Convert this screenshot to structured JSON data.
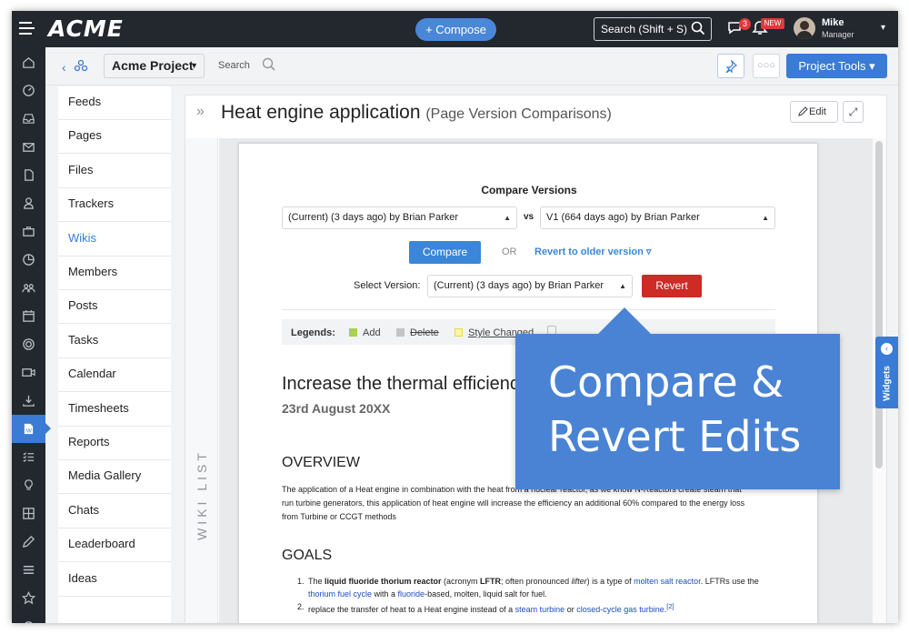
{
  "topbar": {
    "logo": "ACME",
    "compose_label": "+ Compose",
    "search_label": "Search (Shift + S)",
    "chat_badge": "3",
    "bell_badge": "NEW",
    "user_name": "Mike",
    "user_role": "Manager"
  },
  "rail": {
    "icons": [
      "home-icon",
      "dashboard-icon",
      "inbox-icon",
      "mail-icon",
      "file-icon",
      "user-icon",
      "briefcase-icon",
      "pie-chart-icon",
      "group-icon",
      "calendar-icon",
      "target-icon",
      "video-icon",
      "download-icon",
      "wiki-icon",
      "checklist-icon",
      "bulb-icon",
      "grid-icon",
      "pencil-icon",
      "list-icon",
      "star-icon",
      "settings-icon"
    ],
    "active_index": 13
  },
  "subheader": {
    "project": "Acme Project",
    "search_label": "Search",
    "tools_label": "Project Tools",
    "more_label": "○○○"
  },
  "leftnav": {
    "items": [
      "Feeds",
      "Pages",
      "Files",
      "Trackers",
      "Wikis",
      "Members",
      "Posts",
      "Tasks",
      "Calendar",
      "Timesheets",
      "Reports",
      "Media Gallery",
      "Chats",
      "Leaderboard",
      "Ideas"
    ],
    "active": "Wikis"
  },
  "panel": {
    "title": "Heat engine application",
    "subtitle": "(Page Version Comparisons)",
    "edit_label": "Edit",
    "wiki_list_label": "WIKI LIST"
  },
  "compare": {
    "title": "Compare Versions",
    "version_a": "(Current) (3 days ago) by Brian Parker",
    "vs": "vs",
    "version_b": "V1 (664 days ago) by Brian Parker",
    "compare_label": "Compare",
    "or": "OR",
    "revert_older_label": "Revert to older version",
    "select_label": "Select Version:",
    "select_value": "(Current) (3 days ago) by Brian Parker",
    "revert_label": "Revert"
  },
  "legends": {
    "label": "Legends:",
    "add": "Add",
    "delete": "Delete",
    "style": "Style Changed",
    "colors": {
      "add": "#a9cf54",
      "delete": "#c4c4c4",
      "style": "#fff59d"
    }
  },
  "doc": {
    "heading": "Increase the thermal efficiency",
    "date": "23rd August 20XX",
    "overview_title": "OVERVIEW",
    "overview_text": "The application of a Heat engine in combination with the heat from a nuclear reactor, as we know N-Reactors create steam that run turbine generators, this application of heat engine will increase the efficiency an additional 60% compared to the energy loss from Turbine or CCGT methods",
    "goals_title": "GOALS",
    "goal1": {
      "n": "1.",
      "a": "The ",
      "b": "liquid fluoride thorium reactor",
      "c": " (acronym ",
      "d": "LFTR",
      "e": "; often pronounced ",
      "f": "lifter",
      "g": ") is a type of ",
      "h": "molten salt reactor",
      "i": ". LFTRs use the ",
      "j": "thorium fuel cycle",
      "k": " with a ",
      "l": "fluoride",
      "m": "-based, molten, liquid salt for fuel."
    },
    "goal2": {
      "n": "2.",
      "a": "replace the transfer of heat to a Heat engine instead of a ",
      "b": "steam turbine",
      "c": " or ",
      "d": "closed-cycle gas turbine",
      "e": ".",
      "f": "[2]"
    }
  },
  "callout": {
    "line1": "Compare &",
    "line2": "Revert Edits"
  },
  "widgets_label": "Widgets"
}
